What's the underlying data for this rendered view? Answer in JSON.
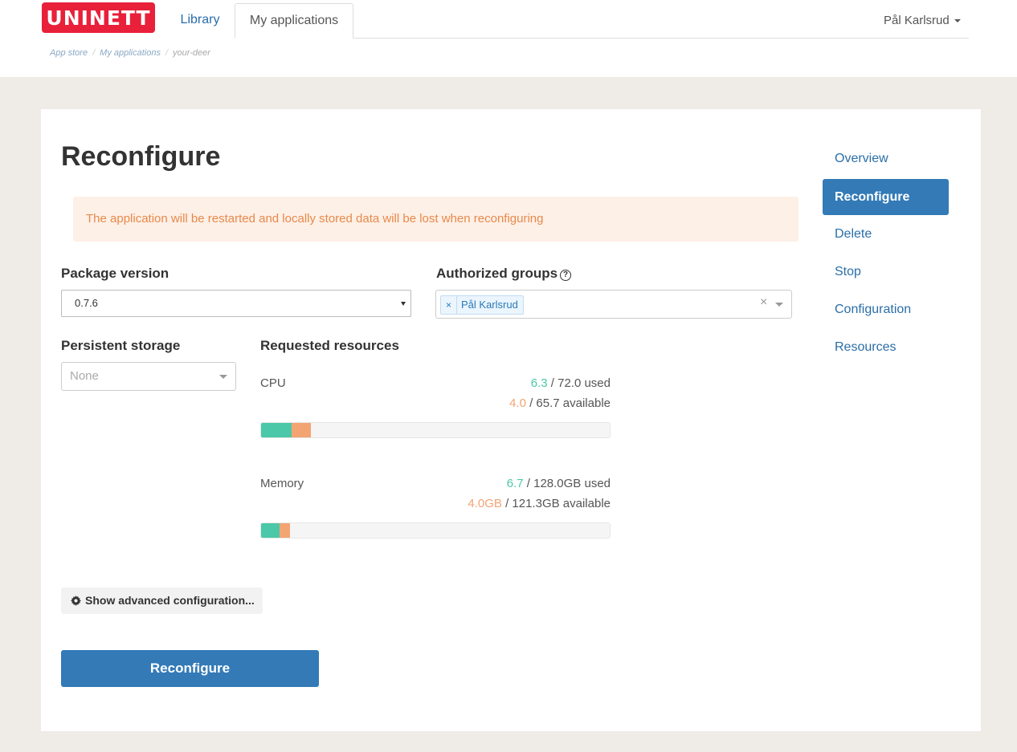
{
  "header": {
    "logo_text": "UNINETT",
    "tabs": [
      {
        "label": "Library"
      },
      {
        "label": "My applications"
      }
    ],
    "user_name": "Pål Karlsrud"
  },
  "breadcrumb": {
    "items": [
      "App store",
      "My applications"
    ],
    "current": "your-deer"
  },
  "page": {
    "title": "Reconfigure",
    "alert": "The application will be restarted and locally stored data will be lost when reconfiguring"
  },
  "form": {
    "package_version": {
      "label": "Package version",
      "value": "0.7.6"
    },
    "authorized_groups": {
      "label": "Authorized groups",
      "help_icon": "question-circle-icon",
      "tags": [
        "Pål Karlsrud"
      ],
      "tag_remove": "×",
      "clear": "×"
    },
    "persistent_storage": {
      "label": "Persistent storage",
      "placeholder": "None"
    },
    "requested_resources": {
      "label": "Requested resources",
      "cpu": {
        "name": "CPU",
        "used_highlight": "6.3",
        "used_rest": " / 72.0 used",
        "req_highlight": "4.0",
        "req_rest": " / 65.7 available",
        "used_value": 6.3,
        "used_total": 72.0,
        "requested_value": 4.0
      },
      "memory": {
        "name": "Memory",
        "used_highlight": "6.7",
        "used_rest": " / 128.0GB used",
        "req_highlight": "4.0GB",
        "req_rest": " / 121.3GB available",
        "used_value": 6.7,
        "used_total": 128.0,
        "requested_value": 4.0
      }
    },
    "advanced_button": "Show advanced configuration...",
    "submit_button": "Reconfigure"
  },
  "sidebar": {
    "items": [
      {
        "label": "Overview",
        "active": false
      },
      {
        "label": "Reconfigure",
        "active": true
      },
      {
        "label": "Delete",
        "active": false
      },
      {
        "label": "Stop",
        "active": false
      },
      {
        "label": "Configuration",
        "active": false
      },
      {
        "label": "Resources",
        "active": false
      }
    ]
  },
  "colors": {
    "logo": "#e8203a",
    "primary": "#337ab7",
    "link": "#2a6ea8",
    "used": "#4ac8a7",
    "requested": "#f3a473",
    "alert_text": "#e8894a",
    "alert_bg": "#fdf0e7"
  }
}
